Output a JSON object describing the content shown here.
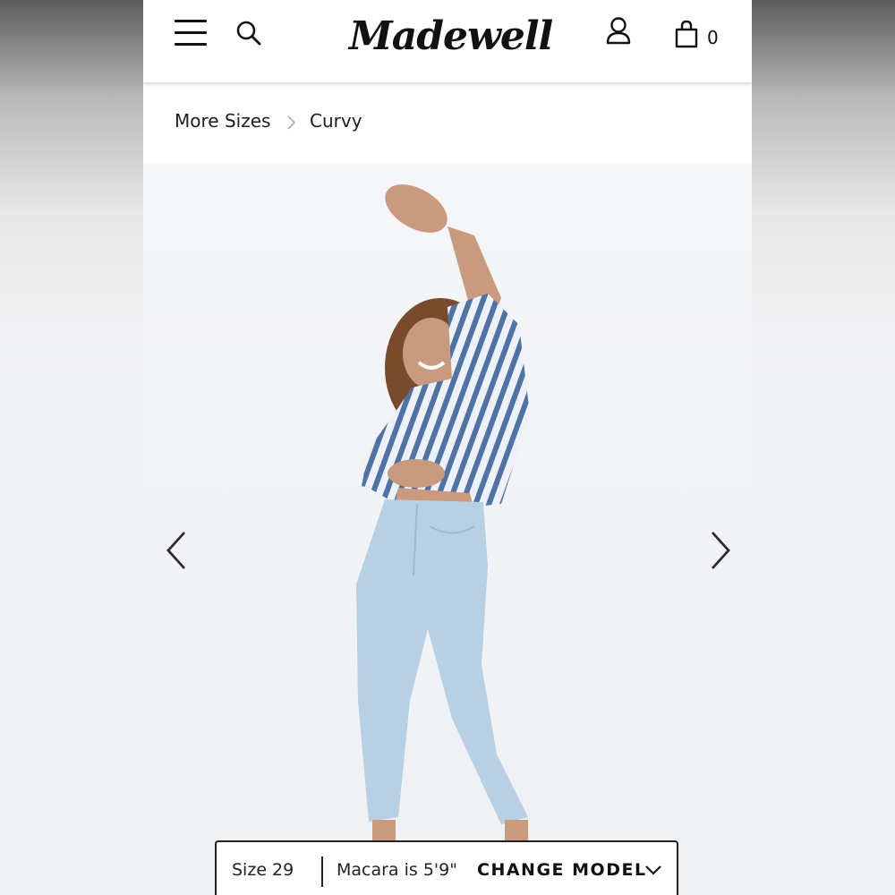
{
  "header": {
    "brand": "Madewell",
    "cart_count": "0",
    "icons": [
      "hamburger-menu-icon",
      "search-icon",
      "account-icon",
      "shopping-bag-icon"
    ]
  },
  "breadcrumb": {
    "items": [
      "More Sizes",
      "Curvy"
    ],
    "separator_icon": "chevron-right-icon"
  },
  "carousel": {
    "prev_icon": "chevron-left-icon",
    "next_icon": "chevron-right-icon"
  },
  "model_info": {
    "size": "Size 29",
    "model": "Macara is 5'9\"",
    "change_label": "CHANGE MODEL",
    "dropdown_icon": "chevron-down-icon"
  },
  "colors": {
    "denim": "#b7d0e4",
    "shirt_stripe": "#4f73a6",
    "skin": "#c99a7d",
    "hair": "#7a4a2c"
  }
}
